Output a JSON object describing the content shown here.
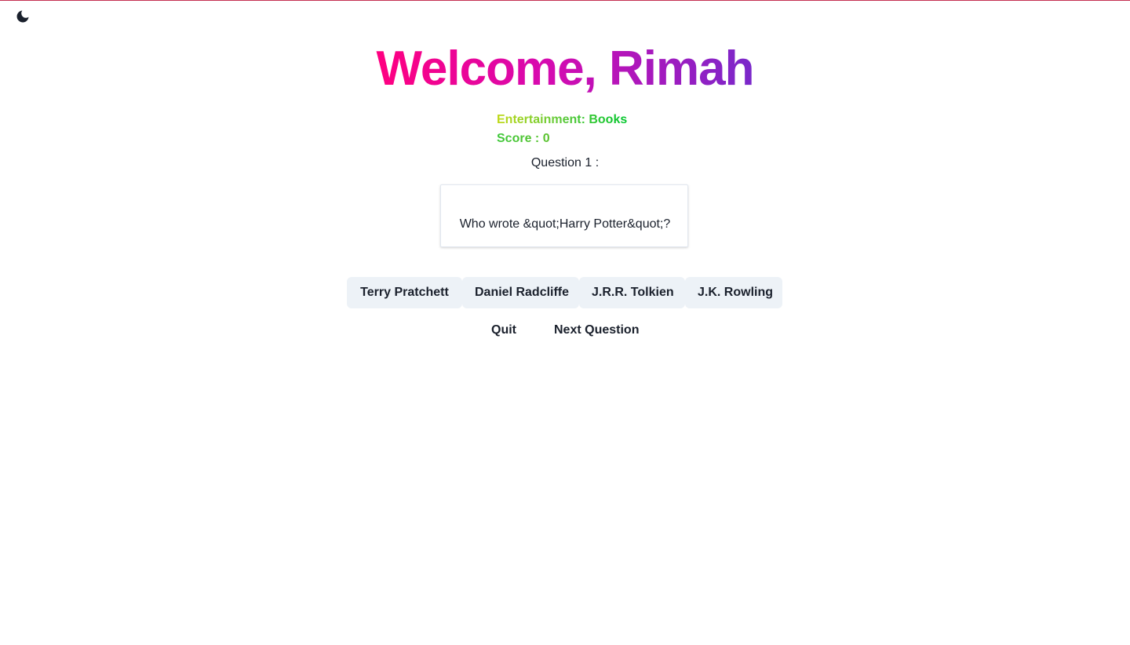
{
  "colors": {
    "accent_top_border": "#c53052",
    "title_gradient": [
      "#ff0080",
      "#7928ca"
    ],
    "meta_gradient": [
      "#c0d918",
      "#00c62b"
    ],
    "answer_bg": "#edf2f7"
  },
  "header": {
    "theme_toggle_icon": "moon-icon"
  },
  "welcome": {
    "title": "Welcome, Rimah"
  },
  "quiz": {
    "category": "Entertainment: Books",
    "score_label": "Score : 0",
    "question_number": "Question 1 :",
    "question_text": "Who wrote &quot;Harry Potter&quot;?"
  },
  "answers": [
    {
      "label": "Terry Pratchett"
    },
    {
      "label": "Daniel Radcliffe"
    },
    {
      "label": "J.R.R. Tolkien"
    },
    {
      "label": "J.K. Rowling"
    }
  ],
  "actions": {
    "quit_label": "Quit",
    "next_label": "Next Question"
  }
}
